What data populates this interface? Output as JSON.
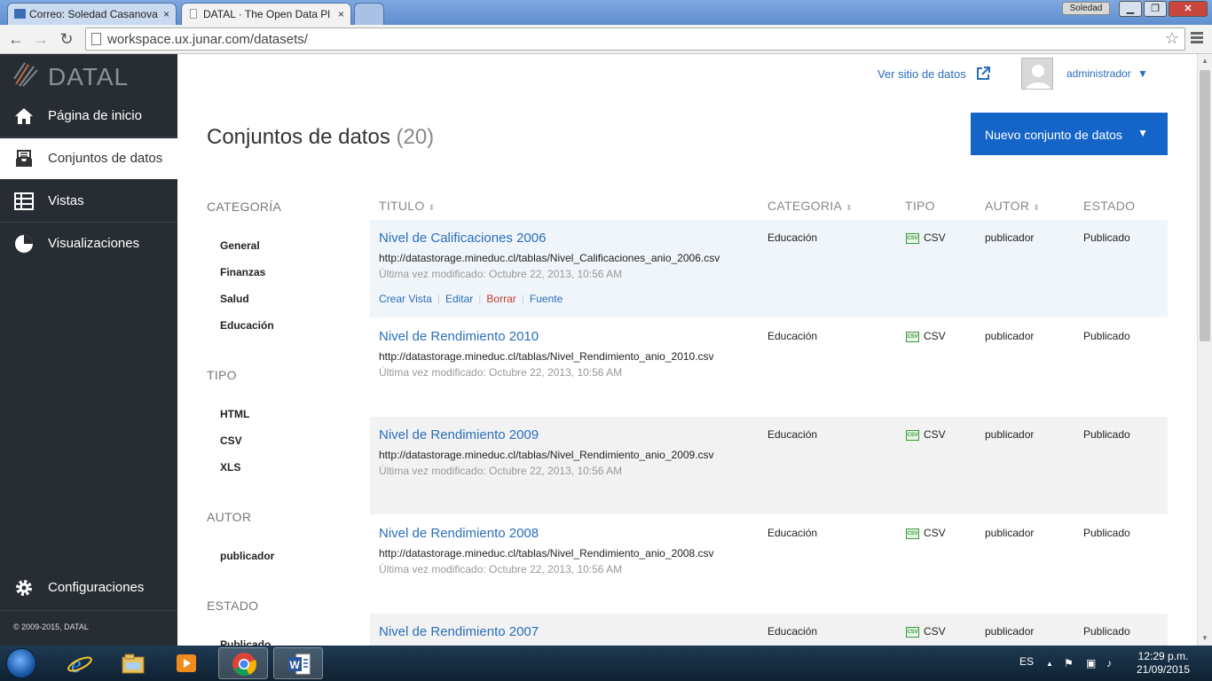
{
  "browser": {
    "tabs": [
      {
        "title": "Correo: Soledad Casanova",
        "close": "×"
      },
      {
        "title": "DATAL · The Open Data Pl",
        "close": "×"
      }
    ],
    "user_chip": "Soledad",
    "url": "workspace.ux.junar.com/datasets/"
  },
  "sidebar": {
    "logo_text": "DATAL",
    "items": [
      {
        "label": "Página de inicio",
        "icon": "home-icon"
      },
      {
        "label": "Conjuntos de datos",
        "icon": "inbox-icon"
      },
      {
        "label": "Vistas",
        "icon": "table-icon"
      },
      {
        "label": "Visualizaciones",
        "icon": "pie-chart-icon"
      }
    ],
    "settings_label": "Configuraciones",
    "copyright": "© 2009-2015, DATAL"
  },
  "header": {
    "view_site": "Ver sitio de datos",
    "user": "administrador",
    "user_caret": "▼"
  },
  "page": {
    "title": "Conjuntos de datos",
    "count": "(20)",
    "new_button": "Nuevo conjunto de datos",
    "new_button_caret": "▼"
  },
  "filters": {
    "categoria": {
      "title": "CATEGORÍA",
      "items": [
        "General",
        "Finanzas",
        "Salud",
        "Educación"
      ]
    },
    "tipo": {
      "title": "TIPO",
      "items": [
        "HTML",
        "CSV",
        "XLS"
      ]
    },
    "autor": {
      "title": "AUTOR",
      "items": [
        "publicador"
      ]
    },
    "estado": {
      "title": "ESTADO",
      "items": [
        "Publicado"
      ]
    }
  },
  "table": {
    "columns": [
      "TITULO",
      "CATEGORIA",
      "TIPO",
      "AUTOR",
      "ESTADO"
    ],
    "sort_glyph": "⬍",
    "type_badge": "CSV",
    "actions": {
      "create_view": "Crear Vista",
      "edit": "Editar",
      "delete": "Borrar",
      "source": "Fuente",
      "separator": "|"
    },
    "rows": [
      {
        "title": "Nivel de Calificaciones 2006",
        "url": "http://datastorage.mineduc.cl/tablas/Nivel_Calificaciones_anio_2006.csv",
        "modified": "Última vez modificado: Octubre 22, 2013, 10:56 AM",
        "category": "Educación",
        "type": "CSV",
        "author": "publicador",
        "status": "Publicado"
      },
      {
        "title": "Nivel de Rendimiento 2010",
        "url": "http://datastorage.mineduc.cl/tablas/Nivel_Rendimiento_anio_2010.csv",
        "modified": "Última vez modificado: Octubre 22, 2013, 10:56 AM",
        "category": "Educación",
        "type": "CSV",
        "author": "publicador",
        "status": "Publicado"
      },
      {
        "title": "Nivel de Rendimiento 2009",
        "url": "http://datastorage.mineduc.cl/tablas/Nivel_Rendimiento_anio_2009.csv",
        "modified": "Última vez modificado: Octubre 22, 2013, 10:56 AM",
        "category": "Educación",
        "type": "CSV",
        "author": "publicador",
        "status": "Publicado"
      },
      {
        "title": "Nivel de Rendimiento 2008",
        "url": "http://datastorage.mineduc.cl/tablas/Nivel_Rendimiento_anio_2008.csv",
        "modified": "Última vez modificado: Octubre 22, 2013, 10:56 AM",
        "category": "Educación",
        "type": "CSV",
        "author": "publicador",
        "status": "Publicado"
      },
      {
        "title": "Nivel de Rendimiento 2007",
        "url": "",
        "modified": "",
        "category": "Educación",
        "type": "CSV",
        "author": "publicador",
        "status": "Publicado"
      }
    ]
  },
  "taskbar": {
    "lang": "ES",
    "time": "12:29 p.m.",
    "date": "21/09/2015"
  },
  "colors": {
    "sidebar_bg": "#282d33",
    "accent": "#1565c9",
    "link": "#2a6ebb",
    "delete": "#c0392b"
  }
}
